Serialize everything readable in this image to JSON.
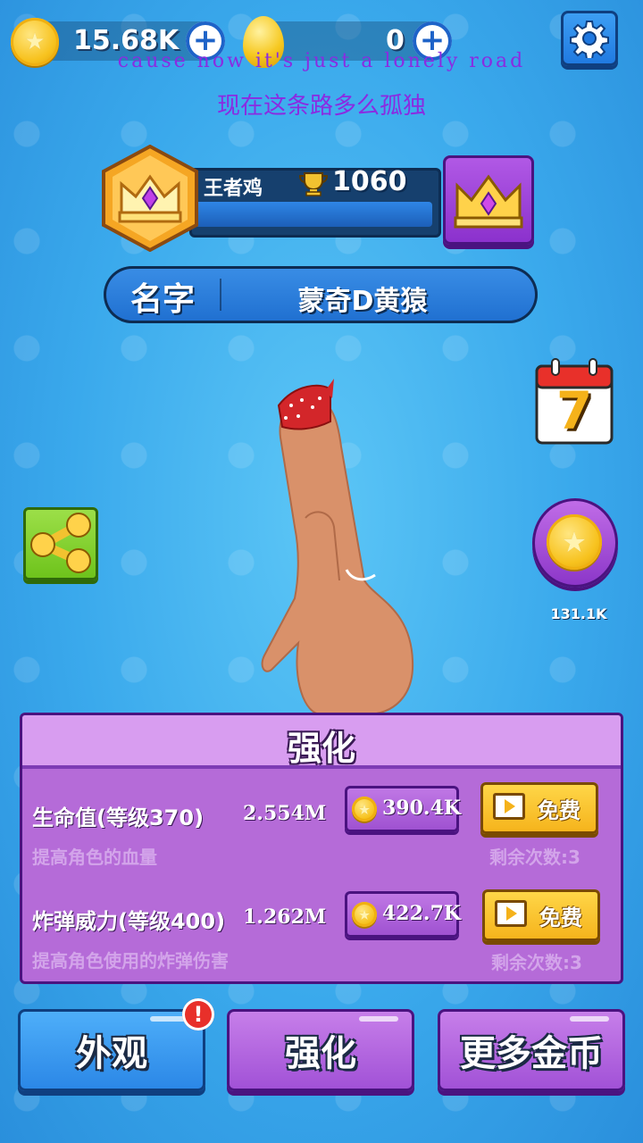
{
  "currency": {
    "gold_value": "15.68K",
    "egg_value": "0"
  },
  "lyrics": {
    "line1": "cause now it's just a lonely road",
    "line2": "现在这条路多么孤独"
  },
  "profile": {
    "player_name": "王者鸡",
    "trophies": "1060",
    "name_label": "名字",
    "name_value": "蒙奇D黄猿"
  },
  "calendar_day": "7",
  "coin_reward_value": "131.1K",
  "upgrade_panel": {
    "title": "强化",
    "rows": [
      {
        "name": "生命值(等级370)",
        "value": "2.554M",
        "description": "提高角色的血量",
        "cost": "390.4K",
        "free_label": "免费",
        "remaining": "剩余次数:3"
      },
      {
        "name": "炸弹威力(等级400)",
        "value": "1.262M",
        "description": "提高角色使用的炸弹伤害",
        "cost": "422.7K",
        "free_label": "免费",
        "remaining": "剩余次数:3"
      }
    ]
  },
  "bottom_nav": {
    "appearance": "外观",
    "upgrade": "强化",
    "more_coins": "更多金币",
    "alert_mark": "!"
  },
  "colors": {
    "background": "#3aa9ec",
    "panel": "#b56bd8",
    "accent_yellow": "#f5b21a"
  }
}
